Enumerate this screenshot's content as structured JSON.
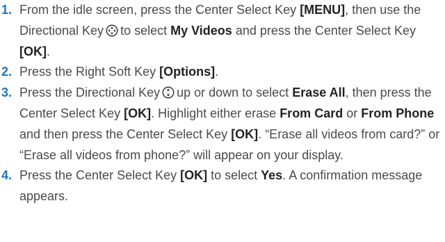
{
  "colors": {
    "step_number": "#1a75c8",
    "body_text": "#4a4a4a",
    "bold_text": "#222222"
  },
  "steps": [
    {
      "number": "1.",
      "parts": [
        "From the idle screen, press the Center Select Key ",
        "[MENU]",
        ", then use the Directional Key",
        "to select ",
        "My Videos",
        " and press the Center Select Key ",
        "[OK]",
        "."
      ],
      "icon": "directional-key-four-way-icon"
    },
    {
      "number": "2.",
      "parts": [
        "Press the Right Soft Key ",
        "[Options]",
        "."
      ]
    },
    {
      "number": "3.",
      "parts": [
        "Press the Directional Key",
        "up or down to select ",
        "Erase All",
        ", then press the Center Select Key ",
        "[OK]",
        ". Highlight either erase ",
        "From Card",
        " or ",
        "From Phone",
        " and then press the Center Select Key ",
        "[OK]",
        ". “Erase all videos from card?” or “Erase all videos from phone?” will appear on your display."
      ],
      "icon": "directional-key-up-down-icon"
    },
    {
      "number": "4.",
      "parts": [
        "Press the Center Select Key ",
        "[OK]",
        " to select ",
        "Yes",
        ". A confirmation message appears."
      ]
    }
  ]
}
